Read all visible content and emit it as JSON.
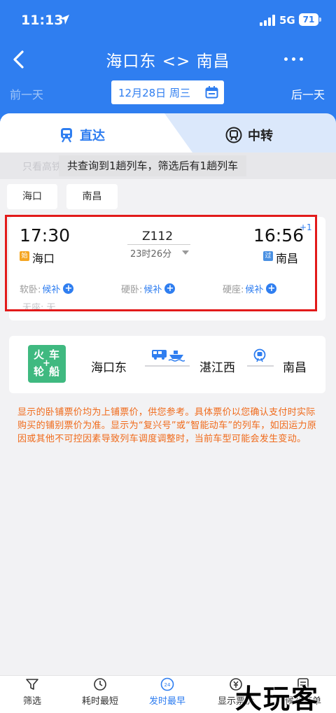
{
  "status_bar": {
    "time": "11:13",
    "network": "5G",
    "battery": "71"
  },
  "nav": {
    "title": "海口东 <> 南昌",
    "prev_day": "前一天",
    "next_day": "后一天",
    "date": "12月28日 周三"
  },
  "tabs": {
    "direct": "直达",
    "transfer": "中转"
  },
  "banner": {
    "hint": "只看高铁",
    "toast": "共查询到1趟列车，筛选后有1趟列车"
  },
  "filters": {
    "from_chip": "海口",
    "to_chip": "南昌"
  },
  "train": {
    "dep_time": "17:30",
    "arr_time": "16:56",
    "plus_day": "+1",
    "train_no": "Z112",
    "duration": "23时26分",
    "from_badge": "始",
    "from_station": "海口",
    "to_badge": "过",
    "to_station": "南昌",
    "seats": [
      {
        "label": "软卧:",
        "status": "候补"
      },
      {
        "label": "硬卧:",
        "status": "候补"
      },
      {
        "label": "硬座:",
        "status": "候补"
      }
    ],
    "extra_seat": "无座: 无"
  },
  "transfer_route": {
    "mode_chars": [
      "火",
      "车",
      "轮",
      "船"
    ],
    "mode_plus": "+",
    "origin": "海口东",
    "via": "湛江西",
    "destination": "南昌"
  },
  "notice": "显示的卧铺票价均为上铺票价，供您参考。具体票价以您确认支付时实际购买的铺别票价为准。显示为“复兴号”或“智能动车”的列车，如因运力原因或其他不可控因素导致列车调度调整时，当前车型可能会发生变动。",
  "bottom_bar": {
    "filter": "筛选",
    "shortest": "耗时最短",
    "earliest": "发时最早",
    "earliest_badge": "24",
    "price": "显示票价",
    "waitlist": "候补订单"
  },
  "watermark": "大玩客",
  "colors": {
    "primary": "#2f7ef0",
    "highlight": "#e21a1a",
    "notice": "#f06a1a",
    "green": "#3fb980"
  }
}
